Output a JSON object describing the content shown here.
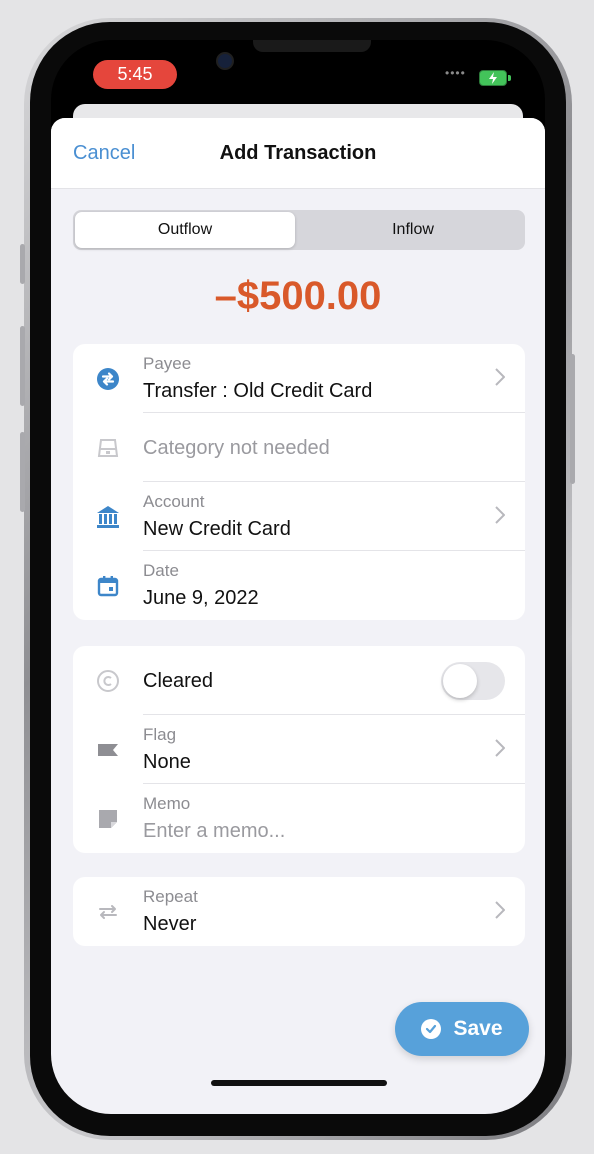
{
  "status_bar": {
    "time": "5:45"
  },
  "nav": {
    "cancel_label": "Cancel",
    "title": "Add Transaction"
  },
  "segment": {
    "outflow_label": "Outflow",
    "inflow_label": "Inflow",
    "selected": "Outflow"
  },
  "amount": "–$500.00",
  "details": {
    "payee": {
      "label": "Payee",
      "value": "Transfer : Old Credit Card",
      "icon": "transfer-icon"
    },
    "category": {
      "value": "Category not needed",
      "icon": "category-icon"
    },
    "account": {
      "label": "Account",
      "value": "New Credit Card",
      "icon": "bank-icon"
    },
    "date": {
      "label": "Date",
      "value": "June 9, 2022",
      "icon": "calendar-icon"
    }
  },
  "options": {
    "cleared": {
      "label": "Cleared",
      "on": false,
      "icon": "cleared-icon"
    },
    "flag": {
      "label": "Flag",
      "value": "None",
      "icon": "flag-icon"
    },
    "memo": {
      "label": "Memo",
      "placeholder": "Enter a memo...",
      "icon": "memo-icon"
    }
  },
  "repeat": {
    "label": "Repeat",
    "value": "Never",
    "icon": "repeat-icon"
  },
  "save_label": "Save",
  "colors": {
    "accent": "#4a8fd2",
    "amount": "#d9592a",
    "save": "#57a1da"
  }
}
